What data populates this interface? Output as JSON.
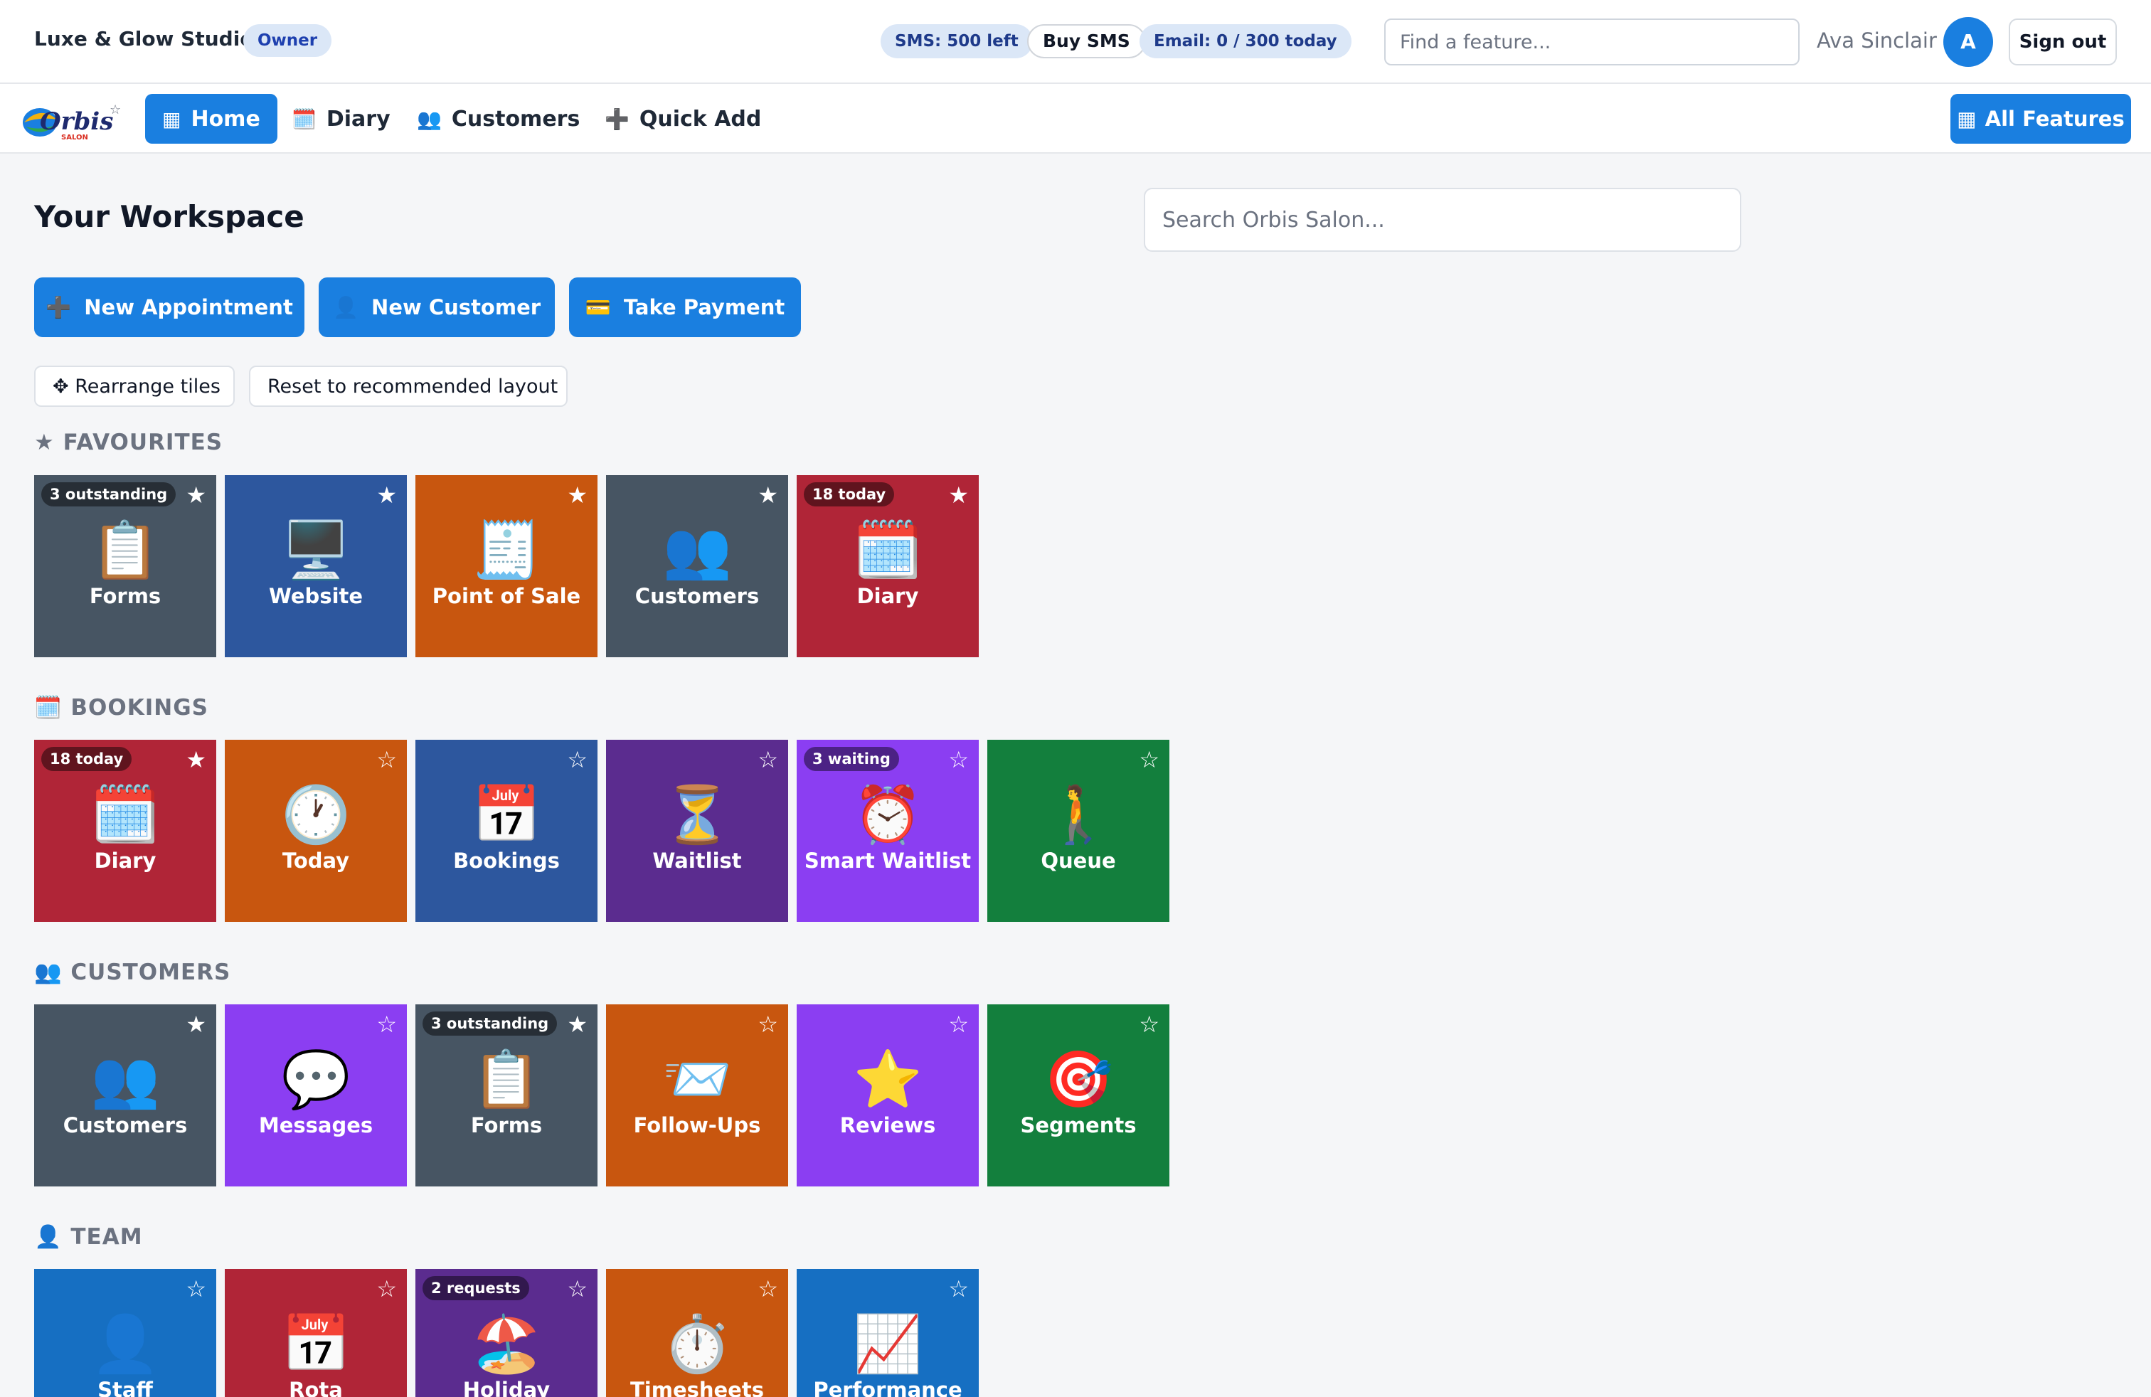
{
  "topbar": {
    "studio_name": "Luxe & Glow Studio",
    "role": "Owner",
    "sms_left": "SMS: 500 left",
    "buy_sms": "Buy SMS",
    "email_quota": "Email: 0 / 300 today",
    "find_placeholder": "Find a feature...",
    "user_name": "Ava Sinclair",
    "avatar_initial": "A",
    "sign_out": "Sign out"
  },
  "nav": {
    "logo_text": "Orbis",
    "logo_subtext": "SALON",
    "home": {
      "icon": "▦",
      "label": "Home"
    },
    "diary": {
      "icon": "🗓️",
      "label": "Diary"
    },
    "customers": {
      "icon": "👥",
      "label": "Customers"
    },
    "quick_add": {
      "icon": "➕",
      "label": "Quick Add"
    },
    "all_features": {
      "icon": "▦",
      "label": "All Features"
    }
  },
  "main": {
    "title": "Your Workspace",
    "search_placeholder": "Search Orbis Salon...",
    "actions": {
      "new_appointment": {
        "icon": "➕",
        "label": "New Appointment"
      },
      "new_customer": {
        "icon": "👤",
        "label": "New Customer"
      },
      "take_payment": {
        "icon": "💳",
        "label": "Take Payment"
      }
    },
    "rearrange": "✥ Rearrange tiles",
    "reset": "Reset to recommended layout"
  },
  "colors": {
    "accent": "#1a7fe0",
    "slate": "#475563",
    "navy": "#2d579e",
    "orange": "#c8560f",
    "red": "#b02537",
    "purple_dark": "#5b2c8f",
    "purple": "#8b3ef2",
    "green": "#137f3d",
    "blue": "#166fc2"
  },
  "sections": [
    {
      "title": "★ FAVOURITES",
      "tiles": [
        {
          "label": "Forms",
          "emoji": "📋",
          "badge": "3 outstanding",
          "starred": true,
          "color": "#475563"
        },
        {
          "label": "Website",
          "emoji": "🖥️",
          "badge": "",
          "starred": true,
          "color": "#2d579e"
        },
        {
          "label": "Point of Sale",
          "emoji": "🧾",
          "badge": "",
          "starred": true,
          "color": "#c8560f"
        },
        {
          "label": "Customers",
          "emoji": "👥",
          "badge": "",
          "starred": true,
          "color": "#475563"
        },
        {
          "label": "Diary",
          "emoji": "🗓️",
          "badge": "18 today",
          "starred": true,
          "color": "#b02537"
        }
      ]
    },
    {
      "title": "🗓️ BOOKINGS",
      "tiles": [
        {
          "label": "Diary",
          "emoji": "🗓️",
          "badge": "18 today",
          "starred": true,
          "color": "#b02537"
        },
        {
          "label": "Today",
          "emoji": "🕐",
          "badge": "",
          "starred": false,
          "color": "#c8560f"
        },
        {
          "label": "Bookings",
          "emoji": "📅",
          "badge": "",
          "starred": false,
          "color": "#2d579e"
        },
        {
          "label": "Waitlist",
          "emoji": "⏳",
          "badge": "",
          "starred": false,
          "color": "#5b2c8f"
        },
        {
          "label": "Smart Waitlist",
          "emoji": "⏰",
          "badge": "3 waiting",
          "starred": false,
          "color": "#8b3ef2"
        },
        {
          "label": "Queue",
          "emoji": "🚶",
          "badge": "",
          "starred": false,
          "color": "#137f3d"
        }
      ]
    },
    {
      "title": "👥 CUSTOMERS",
      "tiles": [
        {
          "label": "Customers",
          "emoji": "👥",
          "badge": "",
          "starred": true,
          "color": "#475563"
        },
        {
          "label": "Messages",
          "emoji": "💬",
          "badge": "",
          "starred": false,
          "color": "#8b3ef2"
        },
        {
          "label": "Forms",
          "emoji": "📋",
          "badge": "3 outstanding",
          "starred": true,
          "color": "#475563"
        },
        {
          "label": "Follow-Ups",
          "emoji": "📨",
          "badge": "",
          "starred": false,
          "color": "#c8560f"
        },
        {
          "label": "Reviews",
          "emoji": "⭐",
          "badge": "",
          "starred": false,
          "color": "#8b3ef2"
        },
        {
          "label": "Segments",
          "emoji": "🎯",
          "badge": "",
          "starred": false,
          "color": "#137f3d"
        }
      ]
    },
    {
      "title": "👤 TEAM",
      "tiles": [
        {
          "label": "Staff",
          "emoji": "👤",
          "badge": "",
          "starred": false,
          "color": "#166fc2"
        },
        {
          "label": "Rota",
          "emoji": "📅",
          "badge": "",
          "starred": false,
          "color": "#b02537"
        },
        {
          "label": "Holiday Requests",
          "emoji": "🏖️",
          "badge": "2 requests",
          "starred": false,
          "color": "#5b2c8f"
        },
        {
          "label": "Timesheets",
          "emoji": "⏱️",
          "badge": "",
          "starred": false,
          "color": "#c8560f"
        },
        {
          "label": "Performance",
          "emoji": "📈",
          "badge": "",
          "starred": false,
          "color": "#166fc2"
        }
      ]
    }
  ]
}
